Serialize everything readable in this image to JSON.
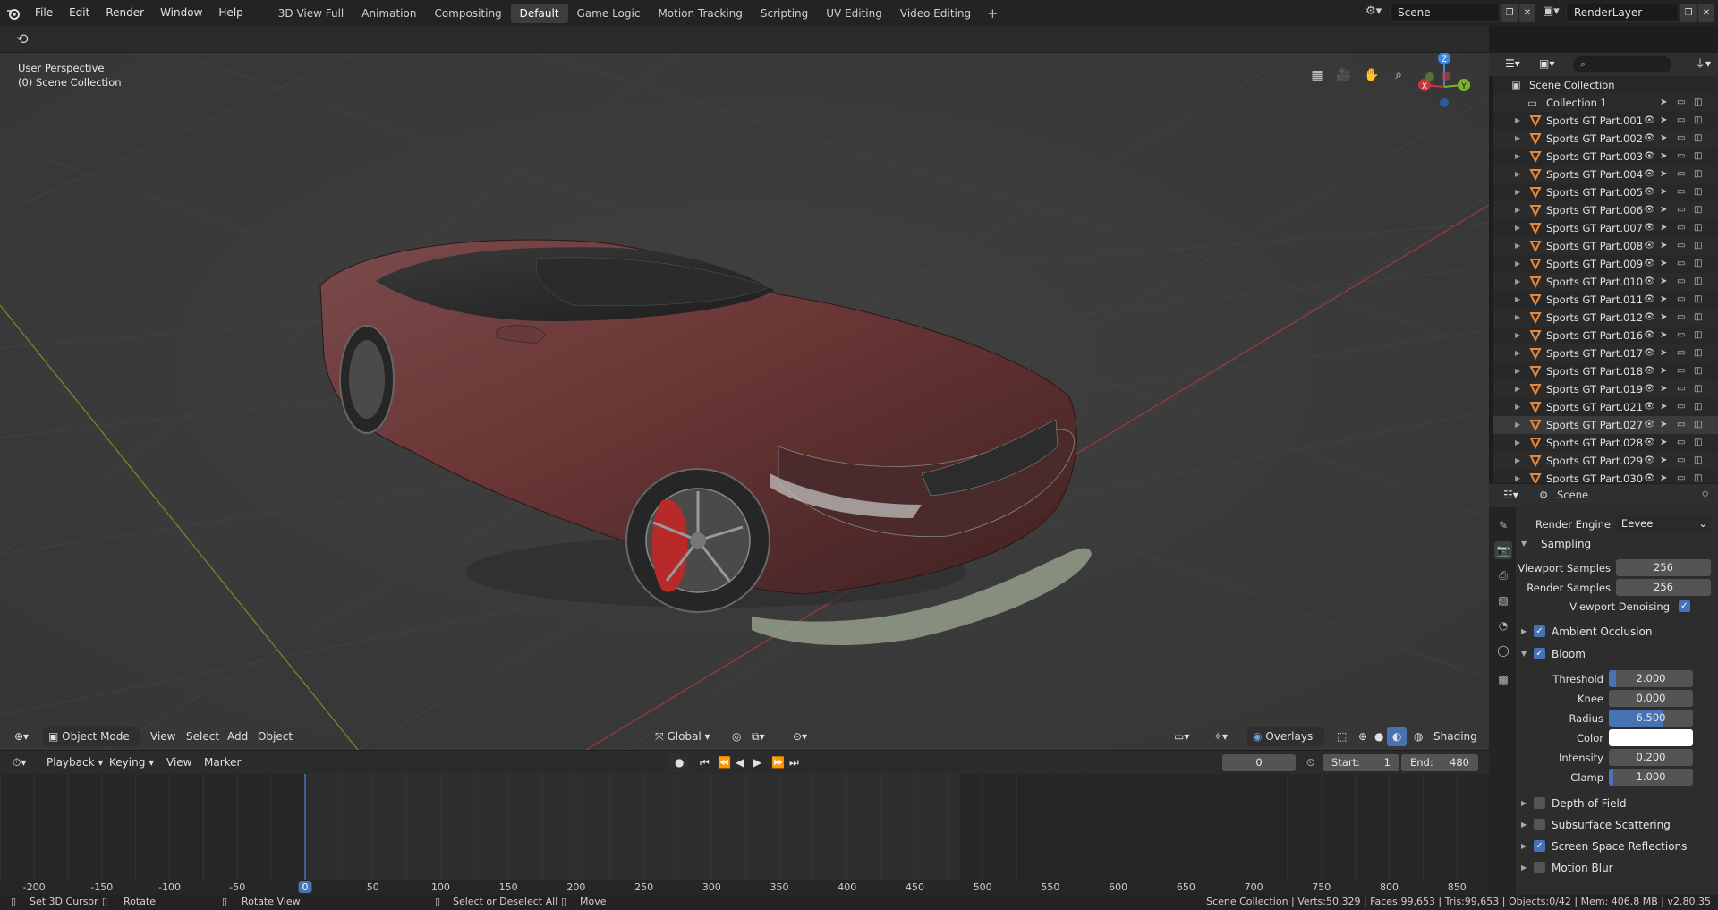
{
  "menu": [
    "File",
    "Edit",
    "Render",
    "Window",
    "Help"
  ],
  "workspaces": [
    {
      "label": "3D View Full"
    },
    {
      "label": "Animation"
    },
    {
      "label": "Compositing"
    },
    {
      "label": "Default",
      "active": true
    },
    {
      "label": "Game Logic"
    },
    {
      "label": "Motion Tracking"
    },
    {
      "label": "Scripting"
    },
    {
      "label": "UV Editing"
    },
    {
      "label": "Video Editing"
    }
  ],
  "add_workspace": "+",
  "scene_name": "Scene",
  "render_layer": "RenderLayer",
  "viewport": {
    "perspective": "User Perspective",
    "collection": "(0) Scene Collection",
    "gizmo": {
      "z": "Z",
      "y": "Y",
      "x": "X"
    }
  },
  "viewport_header": {
    "mode": "Object Mode",
    "menus": [
      "View",
      "Select",
      "Add",
      "Object"
    ],
    "transform": "Global",
    "overlays": "Overlays",
    "shading": "Shading"
  },
  "timeline": {
    "menus": [
      "Playback",
      "Keying",
      "View",
      "Marker"
    ],
    "current_frame": "0",
    "start_label": "Start:",
    "start": "1",
    "end_label": "End:",
    "end": "480",
    "ruler": [
      "-200",
      "-150",
      "-100",
      "-50",
      "0",
      "50",
      "100",
      "150",
      "200",
      "250",
      "300",
      "350",
      "400",
      "450",
      "500",
      "550",
      "600",
      "650",
      "700",
      "750",
      "800",
      "850"
    ],
    "current_ruler": "0"
  },
  "status": {
    "set_cursor": "Set 3D Cursor",
    "rotate": "Rotate",
    "rotate_view": "Rotate View",
    "select": "Select or Deselect All",
    "move": "Move",
    "stats": "Scene Collection | Verts:50,329 | Faces:99,653 | Tris:99,653 | Objects:0/42 | Mem: 406.8 MB | v2.80.35"
  },
  "outliner": {
    "root": "Scene Collection",
    "collection": "Collection 1",
    "objects": [
      "Sports GT Part.001",
      "Sports GT Part.002",
      "Sports GT Part.003",
      "Sports GT Part.004",
      "Sports GT Part.005",
      "Sports GT Part.006",
      "Sports GT Part.007",
      "Sports GT Part.008",
      "Sports GT Part.009",
      "Sports GT Part.010",
      "Sports GT Part.011",
      "Sports GT Part.012",
      "Sports GT Part.016",
      "Sports GT Part.017",
      "Sports GT Part.018",
      "Sports GT Part.019",
      "Sports GT Part.021",
      "Sports GT Part.027",
      "Sports GT Part.028",
      "Sports GT Part.029",
      "Sports GT Part.030"
    ],
    "selected_object": "Sports GT Part.027"
  },
  "properties": {
    "context": "Scene",
    "render_engine_label": "Render Engine",
    "render_engine": "Eevee",
    "sampling": {
      "title": "Sampling",
      "viewport_samples_label": "Viewport Samples",
      "viewport_samples": "256",
      "render_samples_label": "Render Samples",
      "render_samples": "256",
      "denoise_label": "Viewport Denoising",
      "denoise": true
    },
    "ambient_occlusion": {
      "title": "Ambient Occlusion",
      "enabled": true
    },
    "bloom": {
      "title": "Bloom",
      "enabled": true,
      "threshold_label": "Threshold",
      "threshold": "2.000",
      "threshold_fill": 0.08,
      "knee_label": "Knee",
      "knee": "0.000",
      "knee_fill": 0.0,
      "radius_label": "Radius",
      "radius": "6.500",
      "radius_fill": 0.65,
      "color_label": "Color",
      "color": "#ffffff",
      "intensity_label": "Intensity",
      "intensity": "0.200",
      "intensity_fill": 0.0,
      "clamp_label": "Clamp",
      "clamp": "1.000",
      "clamp_fill": 0.05
    },
    "panels_below": [
      {
        "title": "Depth of Field",
        "enabled": false
      },
      {
        "title": "Subsurface Scattering",
        "enabled": false
      },
      {
        "title": "Screen Space Reflections",
        "enabled": true
      },
      {
        "title": "Motion Blur",
        "enabled": false
      }
    ]
  },
  "colors": {
    "accent": "#4772b3",
    "x_axis": "#c8353f",
    "y_axis": "#7cb32f",
    "z_axis": "#3f86dd",
    "object_icon": "#e8883c"
  }
}
